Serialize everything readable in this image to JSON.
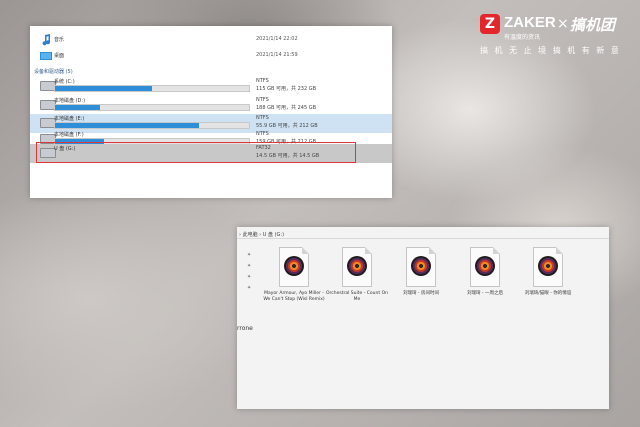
{
  "watermark": {
    "logo_letter": "Z",
    "brand": "ZAKER",
    "separator": "×",
    "partner": "搞机团",
    "tagline": "有温度的资讯",
    "slogan": "搞 机 无 止 境   搞 机 有 新 意"
  },
  "explorer_top": {
    "items": [
      {
        "name": "音乐",
        "date": "2021/1/14 22:02",
        "icon": "music-note-icon"
      },
      {
        "name": "桌面",
        "date": "2021/1/14 21:59",
        "icon": "desktop-icon"
      }
    ],
    "section_label": "设备和驱动器 (5)",
    "drives": [
      {
        "name": "系统 (C:)",
        "fs": "NTFS",
        "free": "115 GB 可用，共 232 GB",
        "used_fraction": 0.5,
        "state": "normal"
      },
      {
        "name": "本地磁盘 (D:)",
        "fs": "NTFS",
        "free": "188 GB 可用，共 245 GB",
        "used_fraction": 0.23,
        "state": "normal"
      },
      {
        "name": "本地磁盘 (E:)",
        "fs": "NTFS",
        "free": "55.9 GB 可用，共 212 GB",
        "used_fraction": 0.74,
        "state": "selected"
      },
      {
        "name": "本地磁盘 (F:)",
        "fs": "NTFS",
        "free": "159 GB 可用，共 212 GB",
        "used_fraction": 0.25,
        "state": "normal"
      },
      {
        "name": "U 盘 (G:)",
        "fs": "FAT32",
        "free": "14.5 GB 可用，共 14.5 GB",
        "used_fraction": 0.0,
        "state": "highlighted"
      }
    ]
  },
  "explorer_bottom": {
    "breadcrumb": "› 此电脑  ›  U 盘 (G:)",
    "side_text": "rrone",
    "files": [
      {
        "name": "Mayor Armour, Ayo Miller - We Can't Stop (Wisl Remix)"
      },
      {
        "name": "Orchestral Suite - Count On Me"
      },
      {
        "name": "刘瑞琦 - 房间时间"
      },
      {
        "name": "刘瑞琦 - 一周之后"
      },
      {
        "name": "刘瑞琦/猫眼 - 你的情谊"
      }
    ]
  }
}
